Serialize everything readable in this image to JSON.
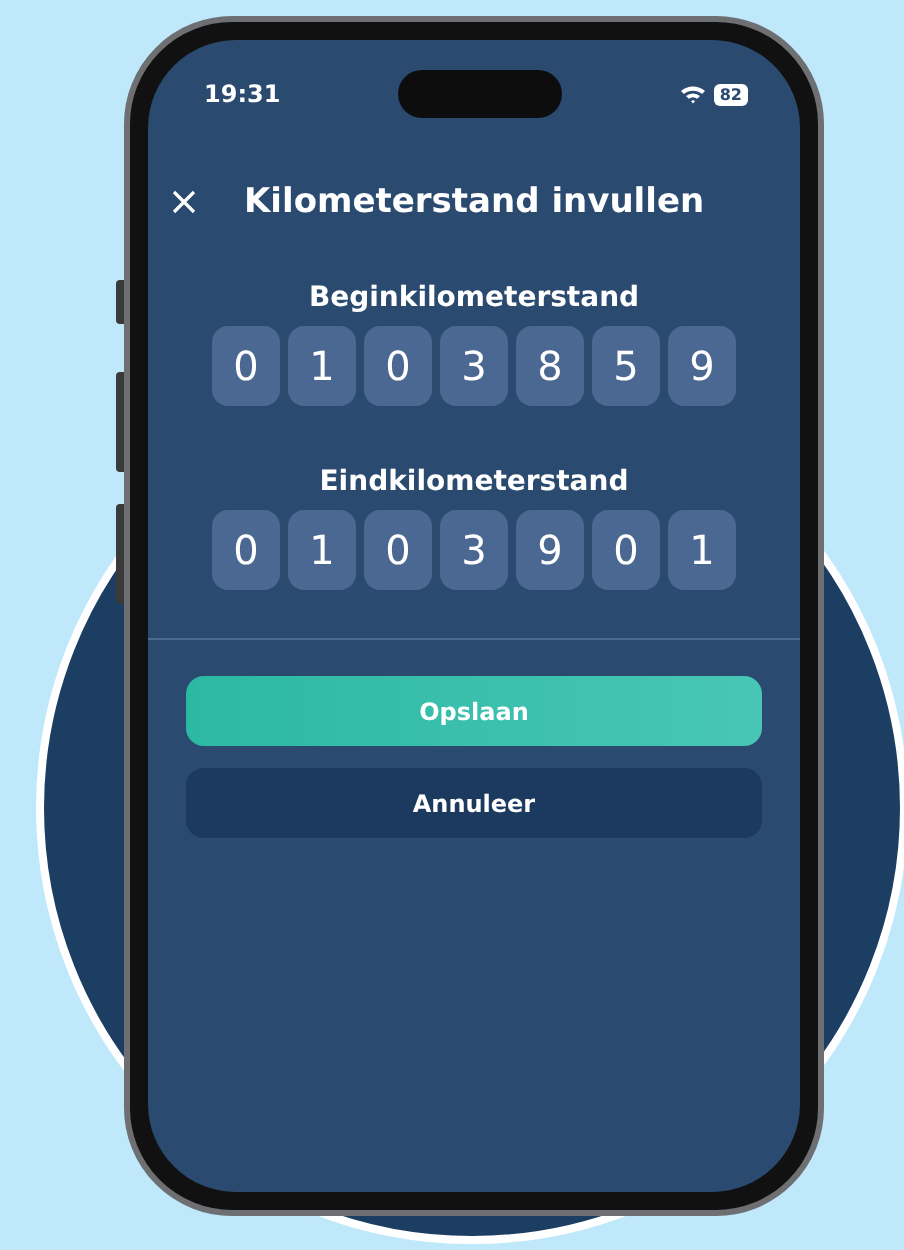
{
  "status_bar": {
    "time": "19:31",
    "battery": "82"
  },
  "header": {
    "title": "Kilometerstand invullen"
  },
  "readings": [
    {
      "label": "Beginkilometerstand",
      "digits": [
        "0",
        "1",
        "0",
        "3",
        "8",
        "5",
        "9"
      ]
    },
    {
      "label": "Eindkilometerstand",
      "digits": [
        "0",
        "1",
        "0",
        "3",
        "9",
        "0",
        "1"
      ]
    }
  ],
  "buttons": [
    {
      "label": "Opslaan",
      "kind": "primary"
    },
    {
      "label": "Annuleer",
      "kind": "secondary"
    }
  ]
}
